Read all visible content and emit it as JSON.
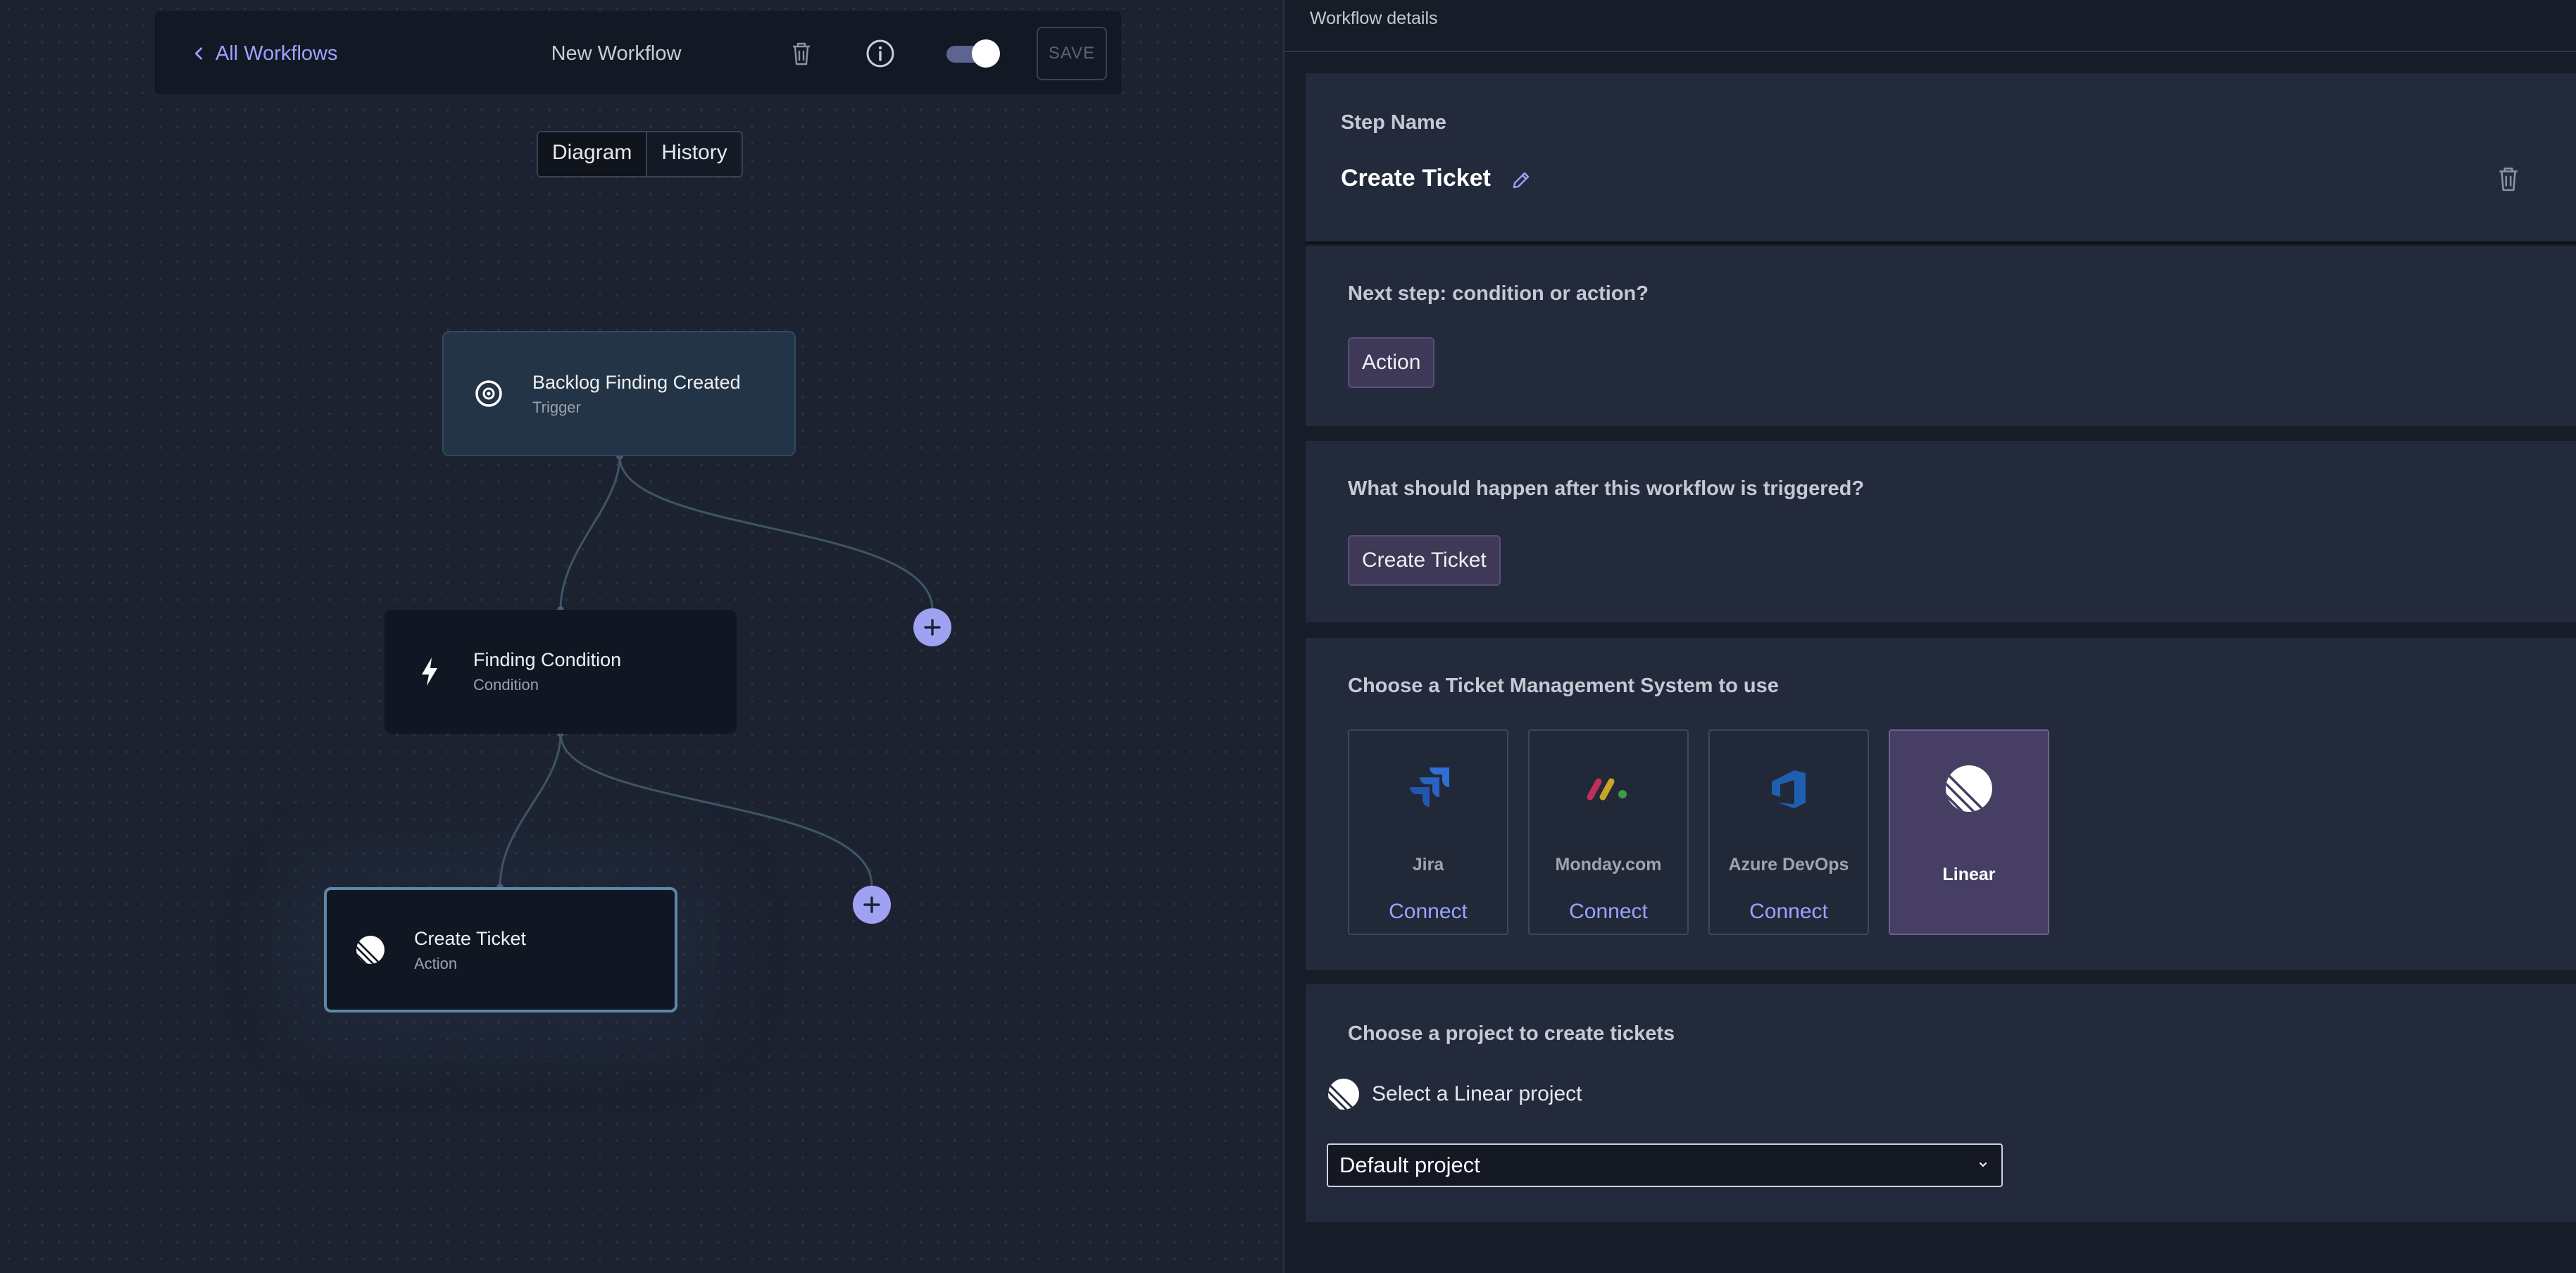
{
  "toolbar": {
    "back_label": "All Workflows",
    "title": "New Workflow",
    "save_label": "SAVE",
    "enabled": true
  },
  "view_tabs": [
    "Diagram",
    "History"
  ],
  "nodes": {
    "trigger": {
      "title": "Backlog Finding Created",
      "subtitle": "Trigger"
    },
    "condition": {
      "title": "Finding Condition",
      "subtitle": "Condition"
    },
    "action": {
      "title": "Create Ticket",
      "subtitle": "Action"
    }
  },
  "panel": {
    "header": "Workflow details",
    "step_name_label": "Step Name",
    "step_name": "Create Ticket",
    "next_step_question": "Next step: condition or action?",
    "next_step_choice": "Action",
    "after_trigger_question": "What should happen after this workflow is triggered?",
    "after_trigger_choice": "Create Ticket",
    "tms_question": "Choose a Ticket Management System to use",
    "tms_options": [
      {
        "name": "Jira",
        "action": "Connect"
      },
      {
        "name": "Monday.com",
        "action": "Connect"
      },
      {
        "name": "Azure DevOps",
        "action": "Connect"
      },
      {
        "name": "Linear",
        "selected": true
      }
    ],
    "project_question": "Choose a project to create tickets",
    "project_hint": "Select a Linear project",
    "project_value": "Default project"
  },
  "colors": {
    "accent": "#9aa3ff",
    "chip_bg": "#3f3856",
    "selected_card_bg": "#463f63"
  },
  "icons": {
    "back": "chevron-left-icon",
    "delete": "trash-icon",
    "info": "info-icon",
    "edit": "pencil-icon",
    "trigger": "target-icon",
    "condition": "lightning-icon",
    "action": "linear-logo-icon",
    "add": "plus-icon"
  }
}
